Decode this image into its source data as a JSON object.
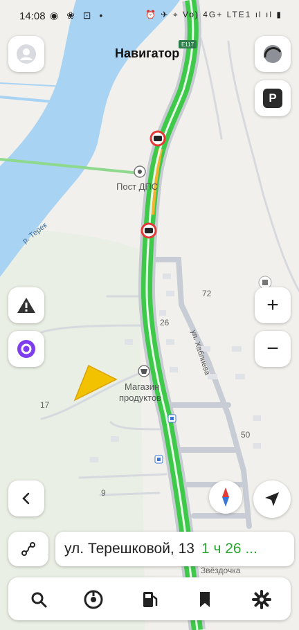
{
  "status_bar": {
    "time": "14:08",
    "left_icons": [
      "whatsapp-icon",
      "app-icon",
      "a-icon",
      "dot"
    ],
    "right_icons": "⏰ ✈ ⌖ Vo) 4G+ LTE1 ıl ıl ▮"
  },
  "app": {
    "title": "Навигатор"
  },
  "map": {
    "labels": {
      "road_name": "E117",
      "post": "Пост ДПС",
      "river": "р. Терек",
      "street": "ул. Хаблиева",
      "shop": "Магазин продуктов",
      "shop_line1": "Магазин",
      "shop_line2": "продуктов",
      "n72": "72",
      "n26": "26",
      "n17": "17",
      "n50": "50",
      "n9": "9",
      "zvezdochka": "Звёздочка"
    },
    "colors": {
      "route": "#3fc94a",
      "water": "#a9d3f3",
      "road": "#c8ccd4"
    }
  },
  "controls": {
    "avatar_icon": "user-avatar-icon",
    "parking_label": "P",
    "zoom_in": "+",
    "zoom_out": "−"
  },
  "route": {
    "address": "ул. Терешковой, 13",
    "eta": "1 ч 26 ..."
  },
  "bottom_nav": [
    "search-icon",
    "music-icon",
    "fuel-icon",
    "bookmark-icon",
    "settings-icon"
  ]
}
